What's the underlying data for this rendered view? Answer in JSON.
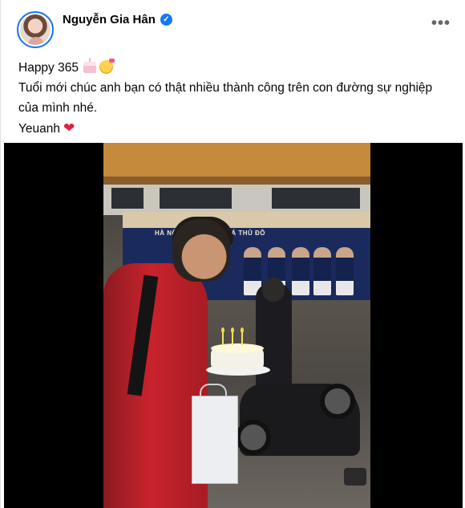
{
  "post": {
    "author": "Nguyễn Gia Hân",
    "verified_label": "✓",
    "more_label": "•••",
    "lines": [
      "Happy 365",
      "Tuổi mới chúc anh bạn có thật nhiều thành công trên con đường sự nghiệp của mình nhé.",
      "Yeuanh"
    ],
    "heart": "❤"
  },
  "media": {
    "banner_text": "HÀ NỘI ... ẢO BÓNG ĐÁ THỦ ĐÔ"
  },
  "colors": {
    "accent": "#1877f2",
    "text": "#050505",
    "heart": "#e41e3f"
  },
  "icons": [
    "verified-badge-icon",
    "more-options-icon",
    "cake-emoji-icon",
    "smiling-face-emoji-icon",
    "heart-emoji-icon"
  ]
}
